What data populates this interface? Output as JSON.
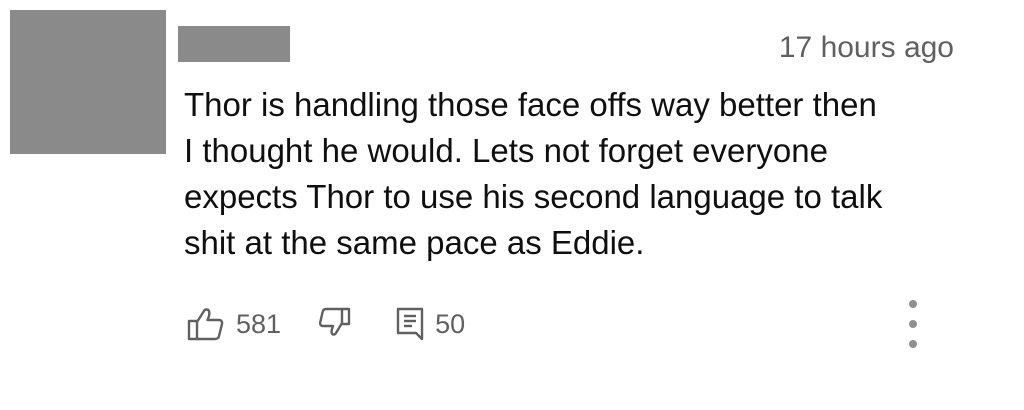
{
  "comment": {
    "timestamp": "17 hours ago",
    "lines": [
      "Thor is handling those face offs way better then",
      "I thought he would. Lets not forget everyone",
      "expects Thor to use his second language to talk",
      "shit at the same pace as Eddie."
    ]
  },
  "actions": {
    "like_count": "581",
    "reply_count": "50"
  },
  "colors": {
    "redaction": "#8a8a8a",
    "secondary_text": "#606060",
    "primary_text": "#0f0f0f"
  },
  "icons": {
    "like": "thumbs-up-icon",
    "dislike": "thumbs-down-icon",
    "reply": "reply-comment-icon",
    "more": "more-vertical-icon"
  }
}
